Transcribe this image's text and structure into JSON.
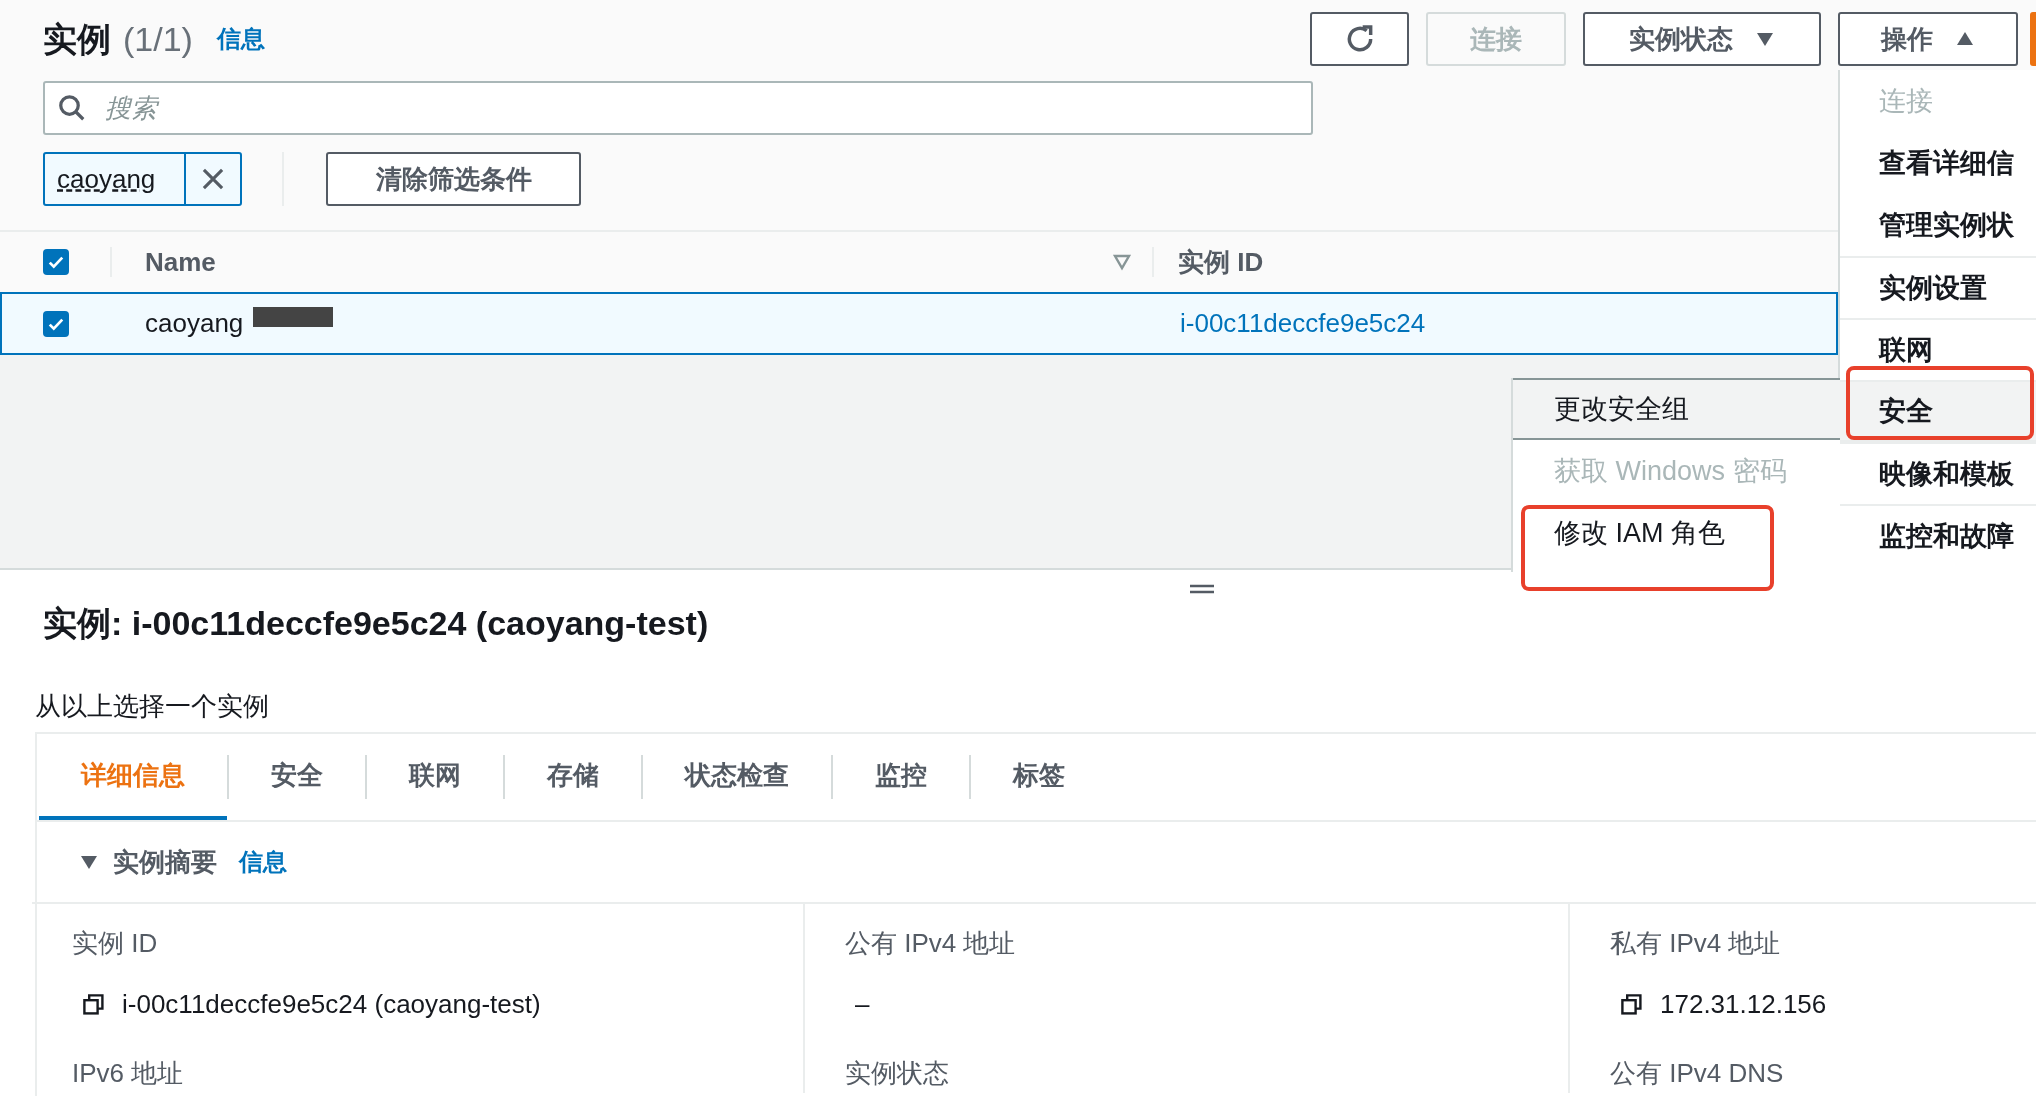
{
  "header": {
    "title": "实例",
    "count": "(1/1)",
    "info_link": "信息"
  },
  "toolbar": {
    "connect": {
      "label": "连接",
      "disabled": true
    },
    "state_menu": {
      "label": "实例状态",
      "expanded": false
    },
    "actions_menu": {
      "label": "操作",
      "expanded": true
    }
  },
  "search": {
    "placeholder": "搜索"
  },
  "filter_token": {
    "value": "caoyang"
  },
  "clear_filters": "清除筛选条件",
  "table": {
    "header_checked": true,
    "columns": [
      {
        "label": "Name",
        "sortable": true
      },
      {
        "label": "实例 ID",
        "sortable": false
      }
    ],
    "rows": [
      {
        "selected": true,
        "checked": true,
        "name": "caoyang",
        "instance_id": "i-00c11deccfe9e5c24"
      }
    ]
  },
  "actions_menu": {
    "items": [
      {
        "label": "连接",
        "disabled": true,
        "selected": false,
        "section_start": false
      },
      {
        "label": "查看详细信",
        "disabled": false,
        "selected": false,
        "section_start": false
      },
      {
        "label": "管理实例状",
        "disabled": false,
        "selected": false,
        "section_start": false
      },
      {
        "label": "实例设置",
        "disabled": false,
        "selected": false,
        "section_start": true
      },
      {
        "label": "联网",
        "disabled": false,
        "selected": false,
        "section_start": true
      },
      {
        "label": "安全",
        "disabled": false,
        "selected": true,
        "section_start": true
      },
      {
        "label": "映像和模板",
        "disabled": false,
        "selected": false,
        "section_start": true
      },
      {
        "label": "监控和故障",
        "disabled": false,
        "selected": false,
        "section_start": true
      }
    ]
  },
  "submenu": {
    "items": [
      {
        "label": "更改安全组",
        "disabled": false,
        "selected": true
      },
      {
        "label": "获取 Windows 密码",
        "disabled": true,
        "selected": false
      },
      {
        "label": "修改 IAM 角色",
        "disabled": false,
        "selected": false
      }
    ]
  },
  "details": {
    "title": "实例: i-00c11deccfe9e5c24 (caoyang-test)",
    "hint": "从以上选择一个实例",
    "tabs": [
      {
        "label": "详细信息",
        "selected": true
      },
      {
        "label": "安全",
        "selected": false
      },
      {
        "label": "联网",
        "selected": false
      },
      {
        "label": "存储",
        "selected": false
      },
      {
        "label": "状态检查",
        "selected": false
      },
      {
        "label": "监控",
        "selected": false
      },
      {
        "label": "标签",
        "selected": false
      }
    ],
    "summary": {
      "title": "实例摘要",
      "expanded": true,
      "info_link": "信息",
      "fields": [
        {
          "label": "实例 ID",
          "value": "i-00c11deccfe9e5c24 (caoyang-test)",
          "copyable": true
        },
        {
          "label": "公有 IPv4 地址",
          "value": "–",
          "copyable": false
        },
        {
          "label": "私有 IPv4 地址",
          "value": "172.31.12.156",
          "copyable": true
        },
        {
          "label": "IPv6 地址"
        },
        {
          "label": "实例状态"
        },
        {
          "label": "公有 IPv4 DNS"
        }
      ]
    }
  }
}
